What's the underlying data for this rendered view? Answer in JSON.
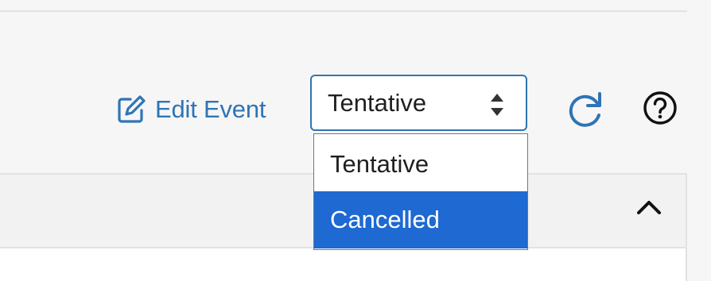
{
  "toolbar": {
    "edit_label": "Edit Event",
    "status_value": "Tentative",
    "status_options": [
      "Tentative",
      "Cancelled"
    ],
    "highlighted_option": "Cancelled"
  },
  "icons": {
    "edit": "edit-icon",
    "select_arrows": "sort-arrows-icon",
    "refresh": "refresh-icon",
    "help": "help-icon",
    "panel_toggle": "chevron-up-icon"
  },
  "colors": {
    "accent": "#2f74b5",
    "option_highlight": "#1e69d2",
    "background": "#f6f6f6",
    "panel_header": "#f2f2f2"
  }
}
